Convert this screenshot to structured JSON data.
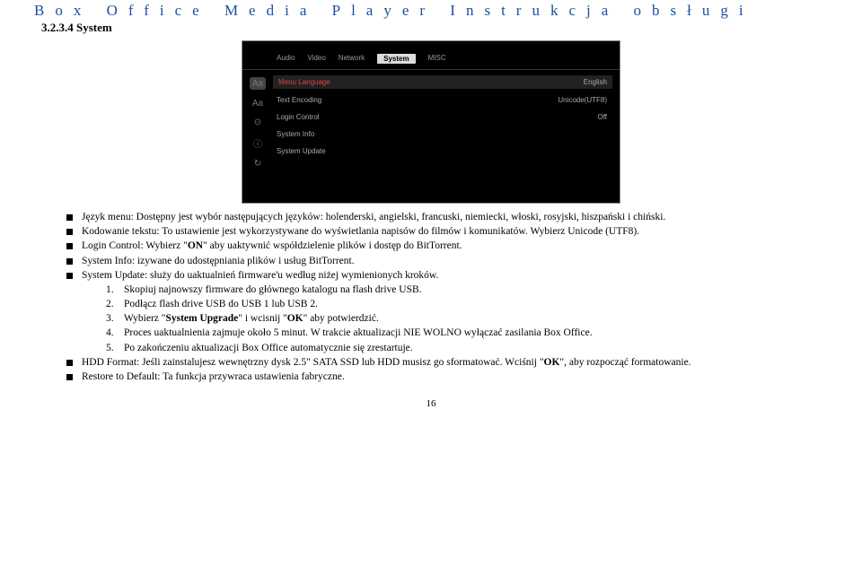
{
  "header": "Box Office Media Player Instrukcja obsługi",
  "section": "3.2.3.4  System",
  "screenshot": {
    "tabs": [
      "Audio",
      "Video",
      "Network",
      "System",
      "MISC"
    ],
    "rows": [
      {
        "label": "Menu Language",
        "value": "English",
        "hi": true
      },
      {
        "label": "Text Encoding",
        "value": "Unicode(UTF8)"
      },
      {
        "label": "Login Control",
        "value": "Off"
      },
      {
        "label": "System Info",
        "value": ""
      },
      {
        "label": "System Update",
        "value": ""
      }
    ]
  },
  "bullets": [
    "Język menu: Dostępny jest wybór następujących języków: holenderski, angielski, francuski, niemiecki, włoski, rosyjski, hiszpański i chiński.",
    "Kodowanie tekstu: To ustawienie jest wykorzystywane do wyświetlania napisów do filmów i komunikatów. Wybierz Unicode (UTF8).",
    "Login Control: Wybierz \"ON\" aby uaktywnić współdzielenie plików i dostęp do BitTorrent.",
    "System Info:    izywane do udostępniania plików i usług BitTorrent.",
    "System Update: służy do uaktualnień firmware'u według niżej wymienionych kroków."
  ],
  "steps": [
    "Skopiuj najnowszy firmware do głównego katalogu na flash drive USB.",
    "Podłącz flash drive USB do USB 1 lub USB 2.",
    "Wybierz \"System Upgrade\" i wcisnij \"OK\" aby potwierdzić.",
    "Proces uaktualnienia zajmuje około 5 minut. W trakcie aktualizacji NIE WOLNO wyłączać zasilania Box Office.",
    "Po zakończeniu aktualizacji Box Office automatycznie się zrestartuje."
  ],
  "bullets2": [
    "HDD Format: Jeśli zainstalujesz wewnętrzny dysk 2.5\" SATA SSD lub HDD musisz go sformatować. Wciśnij \"OK\", aby rozpocząć formatowanie.",
    "Restore to Default: Ta funkcja przywraca ustawienia fabryczne."
  ],
  "pagenum": "16"
}
